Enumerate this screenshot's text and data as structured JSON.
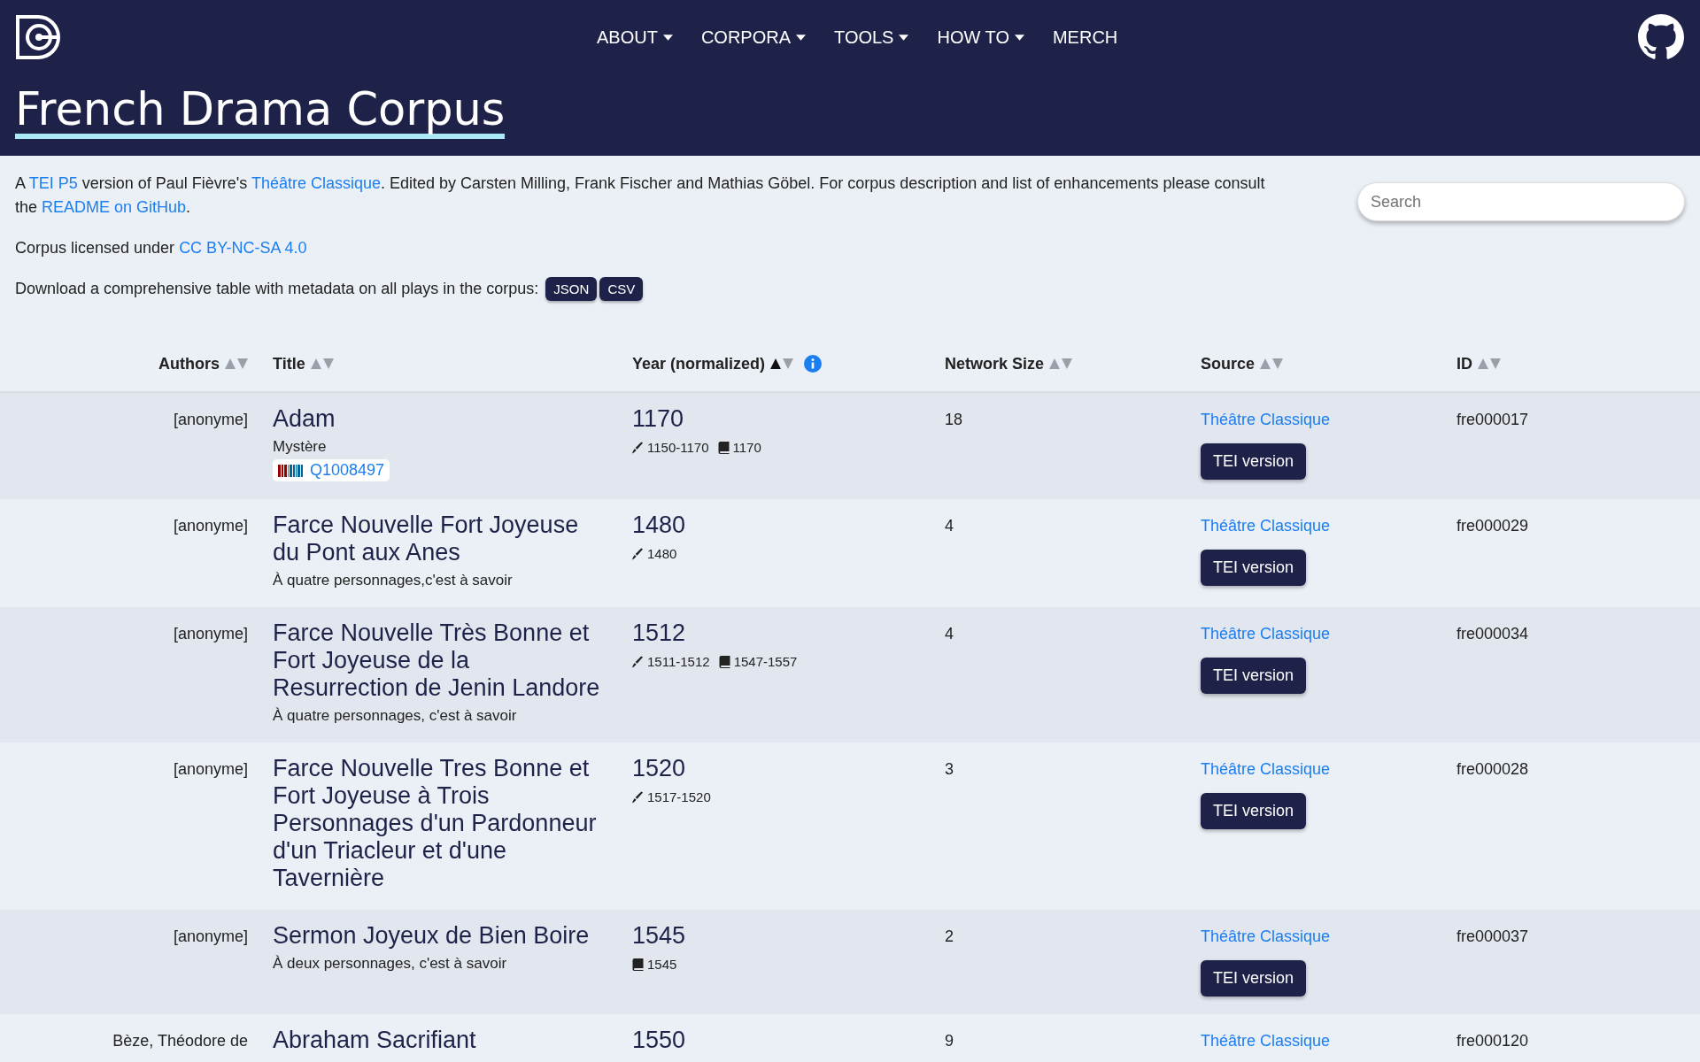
{
  "nav": {
    "items": [
      {
        "label": "ABOUT",
        "dropdown": true
      },
      {
        "label": "CORPORA",
        "dropdown": true
      },
      {
        "label": "TOOLS",
        "dropdown": true
      },
      {
        "label": "HOW TO",
        "dropdown": true
      },
      {
        "label": "MERCH",
        "dropdown": false
      }
    ]
  },
  "page_title": "French Drama Corpus",
  "intro": {
    "parts": [
      {
        "kind": "text",
        "text": "A "
      },
      {
        "kind": "link",
        "text": "TEI P5"
      },
      {
        "kind": "text",
        "text": " version of Paul Fièvre's "
      },
      {
        "kind": "link",
        "text": "Théâtre Classique"
      },
      {
        "kind": "text",
        "text": ". Edited by Carsten Milling, Frank Fischer and Mathias Göbel. For corpus description and list of enhancements please consult the "
      },
      {
        "kind": "link",
        "text": "README on GitHub"
      },
      {
        "kind": "text",
        "text": "."
      }
    ],
    "license_text": "Corpus licensed under",
    "license_link": "CC BY-NC-SA 4.0",
    "download_text": "Download a comprehensive table with metadata on all plays in the corpus:",
    "download_buttons": [
      "JSON",
      "CSV"
    ]
  },
  "search": {
    "placeholder": "Search"
  },
  "table": {
    "columns": [
      {
        "label": "Authors",
        "sorted": false,
        "info": false
      },
      {
        "label": "Title",
        "sorted": false,
        "info": false
      },
      {
        "label": "Year (normalized)",
        "sorted": true,
        "info": true
      },
      {
        "label": "Network Size",
        "sorted": false,
        "info": false
      },
      {
        "label": "Source",
        "sorted": false,
        "info": false
      },
      {
        "label": "ID",
        "sorted": false,
        "info": false
      }
    ],
    "rows": [
      {
        "author": "[anonyme]",
        "title": "Adam",
        "subtitle": "Mystère",
        "wikidata": "Q1008497",
        "year": "1170",
        "dates": [
          {
            "kind": "written",
            "text": "1150-1170"
          },
          {
            "kind": "printed",
            "text": "1170"
          }
        ],
        "network_size": "18",
        "source": "Théâtre Classique",
        "button": "TEI version",
        "id": "fre000017"
      },
      {
        "author": "[anonyme]",
        "title": "Farce Nouvelle Fort Joyeuse du Pont aux Anes",
        "subtitle": "À quatre personnages,c'est à savoir",
        "year": "1480",
        "dates": [
          {
            "kind": "written",
            "text": "1480"
          }
        ],
        "network_size": "4",
        "source": "Théâtre Classique",
        "button": "TEI version",
        "id": "fre000029"
      },
      {
        "author": "[anonyme]",
        "title": "Farce Nouvelle Très Bonne et Fort Joyeuse de la Resurrection de Jenin Landore",
        "subtitle": "À quatre personnages, c'est à savoir",
        "year": "1512",
        "dates": [
          {
            "kind": "written",
            "text": "1511-1512"
          },
          {
            "kind": "printed",
            "text": "1547-1557"
          }
        ],
        "network_size": "4",
        "source": "Théâtre Classique",
        "button": "TEI version",
        "id": "fre000034"
      },
      {
        "author": "[anonyme]",
        "title": "Farce Nouvelle Tres Bonne et Fort Joyeuse à Trois Personnages d'un Pardonneur d'un Triacleur et d'une Tavernière",
        "year": "1520",
        "dates": [
          {
            "kind": "written",
            "text": "1517-1520"
          }
        ],
        "network_size": "3",
        "source": "Théâtre Classique",
        "button": "TEI version",
        "id": "fre000028"
      },
      {
        "author": "[anonyme]",
        "title": "Sermon Joyeux de Bien Boire",
        "subtitle": "À deux personnages, c'est à savoir",
        "year": "1545",
        "dates": [
          {
            "kind": "printed",
            "text": "1545"
          }
        ],
        "network_size": "2",
        "source": "Théâtre Classique",
        "button": "TEI version",
        "id": "fre000037"
      },
      {
        "author": "Bèze, Théodore de",
        "title": "Abraham Sacrifiant",
        "year": "1550",
        "network_size": "9",
        "source": "Théâtre Classique",
        "id": "fre000120"
      }
    ]
  }
}
